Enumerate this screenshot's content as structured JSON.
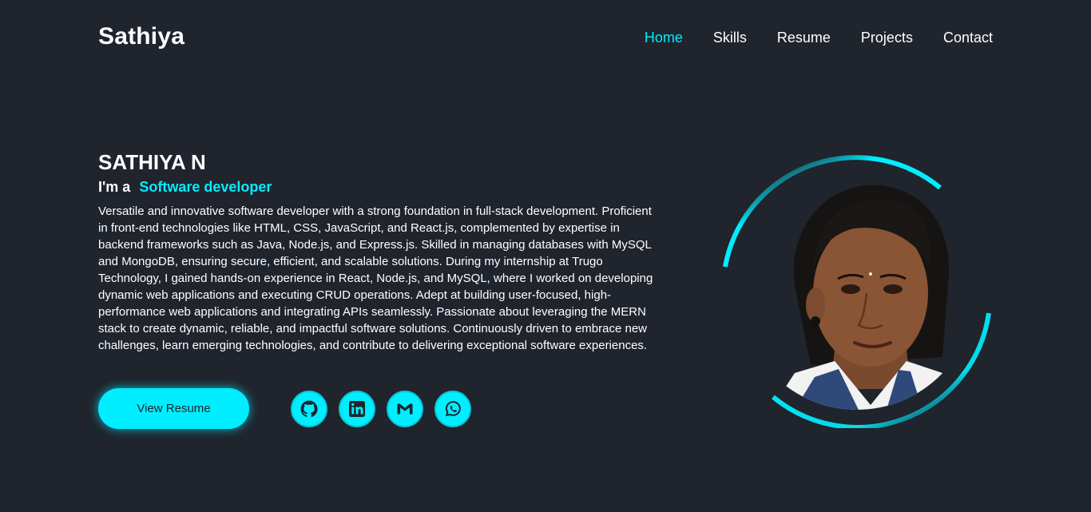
{
  "header": {
    "logo": "Sathiya",
    "nav": [
      {
        "label": "Home",
        "active": true
      },
      {
        "label": "Skills",
        "active": false
      },
      {
        "label": "Resume",
        "active": false
      },
      {
        "label": "Projects",
        "active": false
      },
      {
        "label": "Contact",
        "active": false
      }
    ]
  },
  "home": {
    "name": "SATHIYA N",
    "role_prefix": "I'm a",
    "role": "Software developer",
    "bio": "Versatile and innovative software developer with a strong foundation in full-stack development. Proficient in front-end technologies like HTML, CSS, JavaScript, and React.js, complemented by expertise in backend frameworks such as Java, Node.js, and Express.js. Skilled in managing databases with MySQL and MongoDB, ensuring secure, efficient, and scalable solutions. During my internship at Trugo Technology, I gained hands-on experience in React, Node.js, and MySQL, where I worked on developing dynamic web applications and executing CRUD operations. Adept at building user-focused, high-performance web applications and integrating APIs seamlessly. Passionate about leveraging the MERN stack to create dynamic, reliable, and impactful software solutions. Continuously driven to embrace new challenges, learn emerging technologies, and contribute to delivering exceptional software experiences.",
    "resume_button": "View Resume",
    "socials": [
      {
        "icon": "github-icon"
      },
      {
        "icon": "linkedin-icon"
      },
      {
        "icon": "gmail-icon"
      },
      {
        "icon": "whatsapp-icon"
      }
    ]
  },
  "colors": {
    "background": "#1f242d",
    "accent": "#00eeff",
    "text": "#ffffff"
  }
}
